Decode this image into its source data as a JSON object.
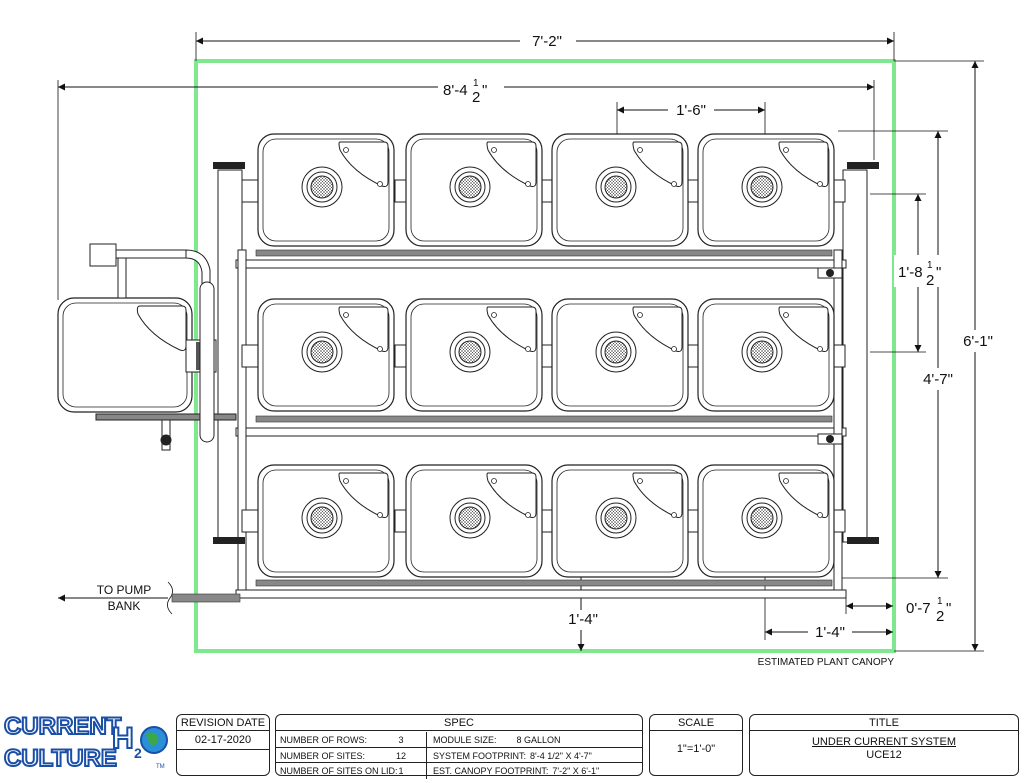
{
  "dimensions": {
    "top_width": "7'-2\"",
    "inner_width": "8'-4",
    "inner_width_frac_num": "1",
    "inner_width_frac_den": "2",
    "inner_width_suffix": "\"",
    "module_spacing": "1'-6\"",
    "row_spacing": "1'-8",
    "row_spacing_frac_num": "1",
    "row_spacing_frac_den": "2",
    "row_spacing_suffix": "\"",
    "overall_height": "6'-1\"",
    "system_height": "4'-7\"",
    "offset": "0'-7",
    "offset_frac_num": "1",
    "offset_frac_den": "2",
    "offset_suffix": "\"",
    "left_offset": "1'-4\"",
    "bottom_offset": "1'-4\""
  },
  "labels": {
    "pump_line1": "TO PUMP",
    "pump_line2": "BANK",
    "canopy": "ESTIMATED PLANT CANOPY"
  },
  "title_block": {
    "revision_header": "REVISION DATE",
    "revision_date": "02-17-2020",
    "spec_header": "SPEC",
    "spec_rows": [
      {
        "label": "NUMBER OF ROWS:",
        "value": "3",
        "label2": "MODULE SIZE:",
        "value2": "8 GALLON"
      },
      {
        "label": "NUMBER OF SITES:",
        "value": "12",
        "label2": "SYSTEM FOOTPRINT:",
        "value2": "8'-4 1/2\" X 4'-7\""
      },
      {
        "label": "NUMBER OF SITES ON LID:",
        "value": "1",
        "label2": "EST. CANOPY FOOTPRINT:",
        "value2": "7'-2\" X 6'-1\""
      }
    ],
    "scale_header": "SCALE",
    "scale_value": "1\"=1'-0\"",
    "title_header": "TITLE",
    "title_line1": "UNDER CURRENT SYSTEM",
    "title_line2": "UCE12"
  },
  "logo": {
    "line1": "CURRENT",
    "line2": "CULTURE",
    "mark": "H",
    "mark_sub": "2",
    "mark_o": "O",
    "tm": "TM"
  },
  "colors": {
    "canopy": "#7fe88f",
    "pipe": "#888888",
    "line": "#222222"
  }
}
